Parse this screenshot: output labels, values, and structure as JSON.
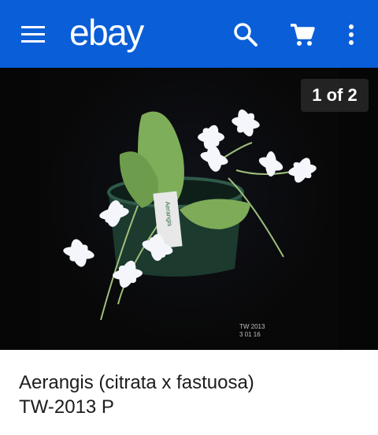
{
  "header": {
    "logo_text": "ebay",
    "menu_icon": "hamburger-icon",
    "search_icon": "search-icon",
    "cart_icon": "cart-icon",
    "more_icon": "more-vertical-icon",
    "bar_color": "#0a5ed7"
  },
  "gallery": {
    "counter": "1 of 2",
    "stamp_line1": "TW 2013",
    "stamp_line2": "3 01 16",
    "plant_tag": "Aerangis"
  },
  "listing": {
    "title_line1": "Aerangis (citrata x fastuosa)",
    "title_line2": "TW-2013 P"
  }
}
